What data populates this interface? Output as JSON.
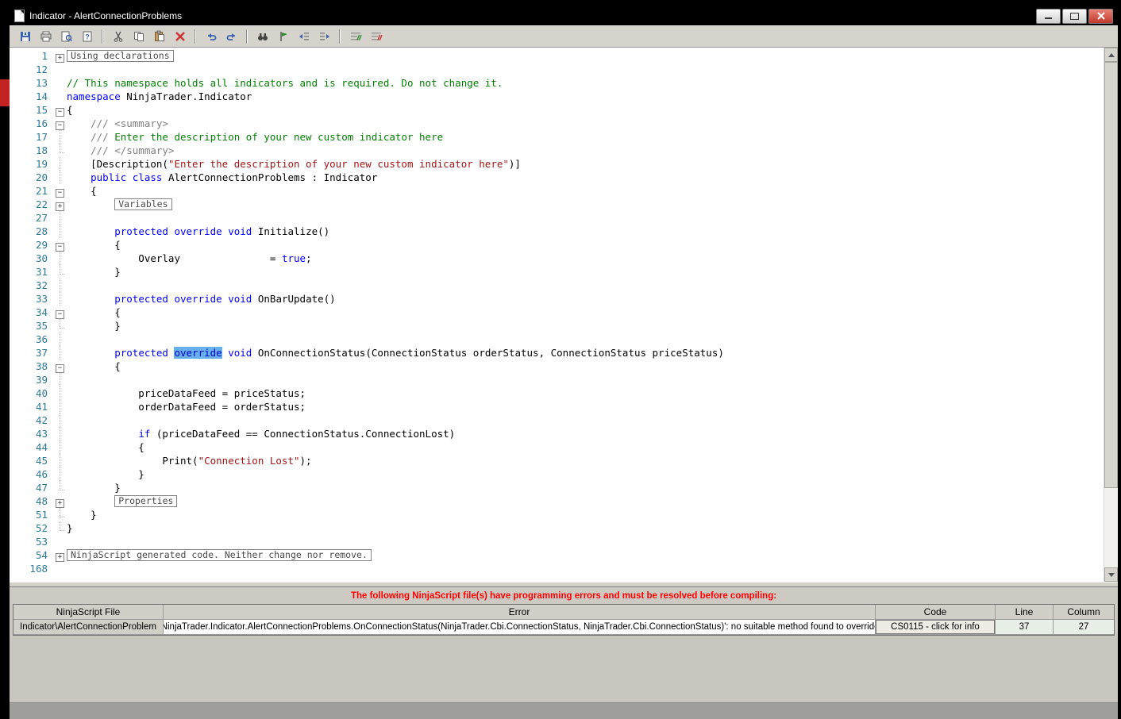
{
  "window": {
    "title": "Indicator - AlertConnectionProblems"
  },
  "toolbar": {
    "icons": [
      "save",
      "print",
      "print-preview",
      "help",
      "cut",
      "copy",
      "paste",
      "delete",
      "undo",
      "redo",
      "find",
      "bookmark",
      "outdent",
      "indent",
      "comment",
      "uncomment"
    ]
  },
  "colors": {
    "keyword": "#0000ff",
    "comment": "#008000",
    "doc_comment": "#808080",
    "string": "#a31515",
    "line_number": "#2b7a9b",
    "selection_bg": "#66b0ee",
    "error_text": "#ff0000"
  },
  "editor": {
    "lines": [
      {
        "n": "1",
        "fold": "plus",
        "s": [
          {
            "c": "boxseg",
            "t": "Using declarations"
          }
        ]
      },
      {
        "n": "12",
        "fold": "none",
        "s": []
      },
      {
        "n": "13",
        "fold": "none",
        "s": [
          {
            "c": "cm",
            "t": "// This namespace holds all indicators and is required. Do not change it."
          }
        ]
      },
      {
        "n": "14",
        "fold": "none",
        "s": [
          {
            "c": "kw",
            "t": "namespace"
          },
          {
            "c": "txt",
            "t": " NinjaTrader.Indicator"
          }
        ]
      },
      {
        "n": "15",
        "fold": "minus",
        "s": [
          {
            "c": "txt",
            "t": "{"
          }
        ]
      },
      {
        "n": "16",
        "fold": "minus",
        "s": [
          {
            "c": "doc",
            "t": "    /// <summary>"
          }
        ]
      },
      {
        "n": "17",
        "fold": "line",
        "s": [
          {
            "c": "doc",
            "t": "    /// "
          },
          {
            "c": "cm",
            "t": "Enter the description of your new custom indicator here"
          }
        ]
      },
      {
        "n": "18",
        "fold": "end",
        "s": [
          {
            "c": "doc",
            "t": "    /// </summary>"
          }
        ]
      },
      {
        "n": "19",
        "fold": "line",
        "s": [
          {
            "c": "txt",
            "t": "    [Description("
          },
          {
            "c": "str",
            "t": "\"Enter the description of your new custom indicator here\""
          },
          {
            "c": "txt",
            "t": ")]"
          }
        ]
      },
      {
        "n": "20",
        "fold": "line",
        "s": [
          {
            "c": "txt",
            "t": "    "
          },
          {
            "c": "kw",
            "t": "public"
          },
          {
            "c": "txt",
            "t": " "
          },
          {
            "c": "kw",
            "t": "class"
          },
          {
            "c": "txt",
            "t": " AlertConnectionProblems : Indicator"
          }
        ]
      },
      {
        "n": "21",
        "fold": "minus",
        "s": [
          {
            "c": "txt",
            "t": "    {"
          }
        ]
      },
      {
        "n": "22",
        "fold": "plus",
        "s": [
          {
            "c": "txt",
            "t": "        "
          },
          {
            "c": "boxseg",
            "t": "Variables"
          }
        ]
      },
      {
        "n": "27",
        "fold": "line",
        "s": []
      },
      {
        "n": "28",
        "fold": "line",
        "s": [
          {
            "c": "txt",
            "t": "        "
          },
          {
            "c": "kw",
            "t": "protected"
          },
          {
            "c": "txt",
            "t": " "
          },
          {
            "c": "kw",
            "t": "override"
          },
          {
            "c": "txt",
            "t": " "
          },
          {
            "c": "kw",
            "t": "void"
          },
          {
            "c": "txt",
            "t": " Initialize()"
          }
        ]
      },
      {
        "n": "29",
        "fold": "minus",
        "s": [
          {
            "c": "txt",
            "t": "        {"
          }
        ]
      },
      {
        "n": "30",
        "fold": "line",
        "s": [
          {
            "c": "txt",
            "t": "            Overlay               = "
          },
          {
            "c": "kw",
            "t": "true"
          },
          {
            "c": "txt",
            "t": ";"
          }
        ]
      },
      {
        "n": "31",
        "fold": "end",
        "s": [
          {
            "c": "txt",
            "t": "        }"
          }
        ]
      },
      {
        "n": "32",
        "fold": "line",
        "s": []
      },
      {
        "n": "33",
        "fold": "line",
        "s": [
          {
            "c": "txt",
            "t": "        "
          },
          {
            "c": "kw",
            "t": "protected"
          },
          {
            "c": "txt",
            "t": " "
          },
          {
            "c": "kw",
            "t": "override"
          },
          {
            "c": "txt",
            "t": " "
          },
          {
            "c": "kw",
            "t": "void"
          },
          {
            "c": "txt",
            "t": " OnBarUpdate()"
          }
        ]
      },
      {
        "n": "34",
        "fold": "minus",
        "s": [
          {
            "c": "txt",
            "t": "        {"
          }
        ]
      },
      {
        "n": "35",
        "fold": "end",
        "s": [
          {
            "c": "txt",
            "t": "        }"
          }
        ]
      },
      {
        "n": "36",
        "fold": "line",
        "s": []
      },
      {
        "n": "37",
        "fold": "line",
        "s": [
          {
            "c": "txt",
            "t": "        "
          },
          {
            "c": "kw",
            "t": "protected"
          },
          {
            "c": "txt",
            "t": " "
          },
          {
            "c": "sel",
            "t": "override"
          },
          {
            "c": "txt",
            "t": " "
          },
          {
            "c": "kw",
            "t": "void"
          },
          {
            "c": "txt",
            "t": " OnConnectionStatus(ConnectionStatus orderStatus, ConnectionStatus priceStatus)"
          }
        ]
      },
      {
        "n": "38",
        "fold": "minus",
        "s": [
          {
            "c": "txt",
            "t": "        {"
          }
        ]
      },
      {
        "n": "39",
        "fold": "line",
        "s": []
      },
      {
        "n": "40",
        "fold": "line",
        "s": [
          {
            "c": "txt",
            "t": "            priceDataFeed = priceStatus;"
          }
        ]
      },
      {
        "n": "41",
        "fold": "line",
        "s": [
          {
            "c": "txt",
            "t": "            orderDataFeed = orderStatus;"
          }
        ]
      },
      {
        "n": "42",
        "fold": "line",
        "s": []
      },
      {
        "n": "43",
        "fold": "line",
        "s": [
          {
            "c": "txt",
            "t": "            "
          },
          {
            "c": "kw",
            "t": "if"
          },
          {
            "c": "txt",
            "t": " (priceDataFeed == ConnectionStatus.ConnectionLost)"
          }
        ]
      },
      {
        "n": "44",
        "fold": "line",
        "s": [
          {
            "c": "txt",
            "t": "            {"
          }
        ]
      },
      {
        "n": "45",
        "fold": "line",
        "s": [
          {
            "c": "txt",
            "t": "                Print("
          },
          {
            "c": "str",
            "t": "\"Connection Lost\""
          },
          {
            "c": "txt",
            "t": ");"
          }
        ]
      },
      {
        "n": "46",
        "fold": "line",
        "s": [
          {
            "c": "txt",
            "t": "            }"
          }
        ]
      },
      {
        "n": "47",
        "fold": "end",
        "s": [
          {
            "c": "txt",
            "t": "        }"
          }
        ]
      },
      {
        "n": "48",
        "fold": "plus",
        "s": [
          {
            "c": "txt",
            "t": "        "
          },
          {
            "c": "boxseg",
            "t": "Properties"
          }
        ]
      },
      {
        "n": "51",
        "fold": "end",
        "s": [
          {
            "c": "txt",
            "t": "    }"
          }
        ]
      },
      {
        "n": "52",
        "fold": "end",
        "s": [
          {
            "c": "txt",
            "t": "}"
          }
        ]
      },
      {
        "n": "53",
        "fold": "none",
        "s": []
      },
      {
        "n": "54",
        "fold": "plus",
        "s": [
          {
            "c": "boxseg",
            "t": "NinjaScript generated code. Neither change nor remove."
          }
        ]
      },
      {
        "n": "168",
        "fold": "none",
        "s": []
      }
    ]
  },
  "errors": {
    "banner": "The following NinjaScript file(s) have programming errors and must be resolved before compiling:",
    "headers": [
      "NinjaScript File",
      "Error",
      "Code",
      "Line",
      "Column"
    ],
    "row": {
      "file": "Indicator\\AlertConnectionProblem",
      "error": "'NinjaTrader.Indicator.AlertConnectionProblems.OnConnectionStatus(NinjaTrader.Cbi.ConnectionStatus, NinjaTrader.Cbi.ConnectionStatus)': no suitable method found to override",
      "code": "CS0115 - click for info",
      "line": "37",
      "column": "27"
    }
  }
}
